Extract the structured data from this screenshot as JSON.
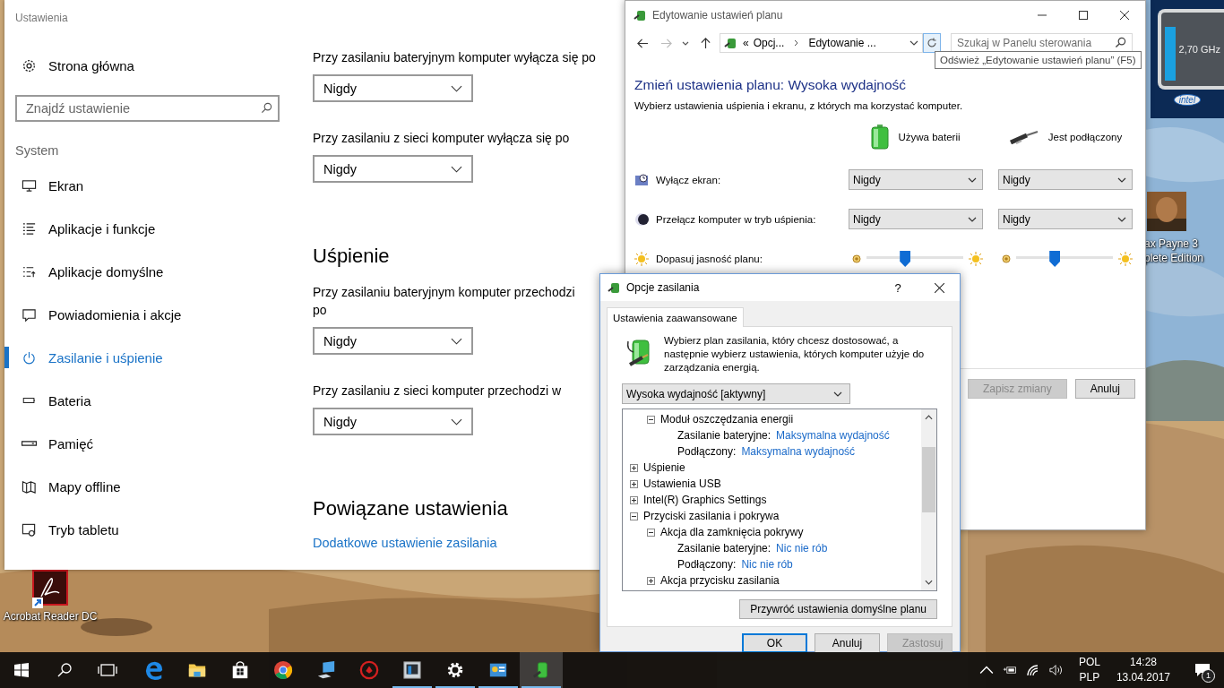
{
  "desktop": {
    "icons": [
      {
        "kind": "acrobat",
        "label_lines": [
          "Acrobat Reader DC"
        ]
      },
      {
        "kind": "game",
        "label_lines": [
          "ax Payne 3",
          "plete Edition"
        ]
      }
    ],
    "gadget": {
      "reading": "2,70 GHz",
      "brand": "intel"
    }
  },
  "settings_window": {
    "title": "Ustawienia",
    "home": "Strona główna",
    "search": {
      "placeholder": "Znajdź ustawienie"
    },
    "group": "System",
    "nav": [
      {
        "kind": "display",
        "label": "Ekran",
        "selected": false
      },
      {
        "kind": "apps",
        "label": "Aplikacje i funkcje",
        "selected": false
      },
      {
        "kind": "default-apps",
        "label": "Aplikacje domyślne",
        "selected": false
      },
      {
        "kind": "notifications",
        "label": "Powiadomienia i akcje",
        "selected": false
      },
      {
        "kind": "power",
        "label": "Zasilanie i uśpienie",
        "selected": true
      },
      {
        "kind": "battery",
        "label": "Bateria",
        "selected": false
      },
      {
        "kind": "storage",
        "label": "Pamięć",
        "selected": false
      },
      {
        "kind": "maps",
        "label": "Mapy offline",
        "selected": false
      },
      {
        "kind": "tablet",
        "label": "Tryb tabletu",
        "selected": false
      }
    ],
    "sections": [
      {
        "settings": [
          {
            "label_lines": [
              "Przy zasilaniu bateryjnym komputer wyłącza się po"
            ],
            "value": "Nigdy"
          },
          {
            "label_lines": [
              "Przy zasilaniu z sieci komputer wyłącza się po"
            ],
            "value": "Nigdy"
          }
        ]
      },
      {
        "heading": "Uśpienie",
        "settings": [
          {
            "label_lines": [
              "Przy zasilaniu bateryjnym komputer przechodzi",
              "po"
            ],
            "value": "Nigdy"
          },
          {
            "label_lines": [
              "Przy zasilaniu z sieci komputer przechodzi w"
            ],
            "value": "Nigdy"
          }
        ]
      },
      {
        "heading": "Powiązane ustawienia",
        "links": [
          "Dodatkowe ustawienie zasilania"
        ]
      }
    ]
  },
  "control_panel": {
    "title": "Edytowanie ustawień planu",
    "address": {
      "prefix": "«",
      "crumbs": [
        "Opcj...",
        "Edytowanie ..."
      ]
    },
    "search": {
      "placeholder": "Szukaj w Panelu sterowania"
    },
    "tooltip": "Odśwież „Edytowanie ustawień planu” (F5)",
    "heading": "Zmień ustawienia planu: Wysoka wydajność",
    "subtitle": "Wybierz ustawienia uśpienia i ekranu, z których ma korzystać komputer.",
    "columns": [
      {
        "kind": "battery",
        "label": "Używa baterii"
      },
      {
        "kind": "plug",
        "label": "Jest podłączony"
      }
    ],
    "rows": [
      {
        "kind": "select",
        "label": "Wyłącz ekran:",
        "values": [
          "Nigdy",
          "Nigdy"
        ]
      },
      {
        "kind": "select",
        "label": "Przełącz komputer w tryb uśpienia:",
        "values": [
          "Nigdy",
          "Nigdy"
        ]
      },
      {
        "kind": "slider",
        "label": "Dopasuj jasność planu:",
        "sliders": [
          {
            "level": 0.4
          },
          {
            "level": 0.4
          }
        ]
      }
    ],
    "buttons": [
      {
        "label": "Zapisz zmiany",
        "disabled": true
      },
      {
        "label": "Anuluj",
        "disabled": false
      }
    ]
  },
  "power_options_dialog": {
    "title": "Opcje zasilania",
    "help": "?",
    "tabs": [
      {
        "label": "Ustawienia zaawansowane",
        "selected": true
      }
    ],
    "description": "Wybierz plan zasilania, który chcesz dostosować, a następnie wybierz ustawienia, których komputer użyje do zarządzania energią.",
    "plan": "Wysoka wydajność [aktywny]",
    "tree": [
      {
        "children": [
          {
            "label": "Moduł oszczędzania energii",
            "expanded": true,
            "children": [
              {
                "label": "Zasilanie bateryjne:",
                "value": "Maksymalna wydajność"
              },
              {
                "label": "Podłączony:",
                "value": "Maksymalna wydajność"
              }
            ]
          }
        ]
      },
      {
        "label": "Uśpienie",
        "expanded": false
      },
      {
        "label": "Ustawienia USB",
        "expanded": false
      },
      {
        "label": "Intel(R) Graphics Settings",
        "expanded": false
      },
      {
        "label": "Przyciski zasilania i pokrywa",
        "expanded": true,
        "children": [
          {
            "label": "Akcja dla zamknięcia pokrywy",
            "expanded": true,
            "children": [
              {
                "label": "Zasilanie bateryjne:",
                "value": "Nic nie rób"
              },
              {
                "label": "Podłączony:",
                "value": "Nic nie rób"
              }
            ]
          },
          {
            "label": "Akcja przycisku zasilania",
            "expanded": false
          }
        ]
      }
    ],
    "restore_button": "Przywróć ustawienia domyślne planu",
    "buttons": [
      {
        "label": "OK",
        "default": true,
        "disabled": false
      },
      {
        "label": "Anuluj",
        "default": false,
        "disabled": false
      },
      {
        "label": "Zastosuj",
        "default": false,
        "disabled": true
      }
    ]
  },
  "taskbar": {
    "apps": [
      {
        "kind": "edge",
        "running": false,
        "selected": false
      },
      {
        "kind": "folder",
        "running": false,
        "selected": false
      },
      {
        "kind": "store",
        "running": false,
        "selected": false
      },
      {
        "kind": "chrome",
        "running": false,
        "selected": false
      },
      {
        "kind": "computer",
        "running": false,
        "selected": false
      },
      {
        "kind": "red-ring",
        "running": false,
        "selected": false
      },
      {
        "kind": "tile",
        "running": true,
        "selected": false
      },
      {
        "kind": "gear",
        "running": true,
        "selected": false
      },
      {
        "kind": "panel",
        "running": true,
        "selected": false
      },
      {
        "kind": "battery",
        "running": true,
        "selected": true
      }
    ],
    "tray": {
      "language": [
        "POL",
        "PLP"
      ],
      "time": "14:28",
      "date": "13.04.2017",
      "notifications": "1"
    }
  }
}
